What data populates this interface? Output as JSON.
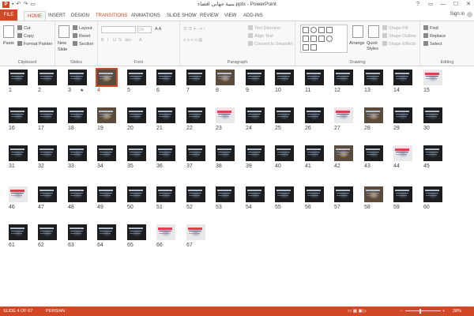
{
  "window": {
    "title": "بنبية جهاني افضاء.pptx - PowerPoint",
    "app_icon": "P",
    "qat": [
      "save-icon",
      "undo-icon",
      "redo-icon",
      "start-from-beginning-icon"
    ],
    "controls": [
      "?",
      "▭",
      "—",
      "☐",
      "✕"
    ]
  },
  "tabs": {
    "file": "FILE",
    "items": [
      "HOME",
      "INSERT",
      "DESIGN",
      "TRANSITIONS",
      "ANIMATIONS",
      "SLIDE SHOW",
      "REVIEW",
      "VIEW",
      "ADD-INS"
    ],
    "active": "HOME",
    "sign_in": "Sign in"
  },
  "ribbon": {
    "clipboard": {
      "label": "Clipboard",
      "paste": "Paste",
      "cut": "Cut",
      "copy": "Copy",
      "format_painter": "Format Painter"
    },
    "slides": {
      "label": "Slides",
      "new_slide": "New",
      "new_slide2": "Slide",
      "layout": "Layout",
      "reset": "Reset",
      "section": "Section"
    },
    "font": {
      "label": "Font",
      "size": "24"
    },
    "paragraph": {
      "label": "Paragraph",
      "text_direction": "Text Direction",
      "align_text": "Align Text",
      "convert_smartart": "Convert to SmartArt"
    },
    "drawing": {
      "label": "Drawing",
      "arrange": "Arrange",
      "quick_styles": "Quick Styles",
      "quick": "Quick",
      "styles": "Styles",
      "shape_fill": "Shape Fill",
      "shape_outline": "Shape Outline",
      "shape_effects": "Shape Effects"
    },
    "editing": {
      "label": "Editing",
      "find": "Find",
      "replace": "Replace",
      "select": "Select"
    }
  },
  "slides": {
    "count": 67,
    "selected": 4,
    "numbers": [
      "1",
      "2",
      "3",
      "4",
      "5",
      "6",
      "7",
      "8",
      "9",
      "10",
      "11",
      "12",
      "13",
      "14",
      "15",
      "16",
      "17",
      "18",
      "19",
      "20",
      "21",
      "22",
      "23",
      "24",
      "25",
      "26",
      "27",
      "28",
      "29",
      "30",
      "31",
      "32",
      "33",
      "34",
      "35",
      "36",
      "37",
      "38",
      "39",
      "40",
      "41",
      "42",
      "43",
      "44",
      "45",
      "46",
      "47",
      "48",
      "49",
      "50",
      "51",
      "52",
      "53",
      "54",
      "55",
      "56",
      "57",
      "58",
      "59",
      "60",
      "61",
      "62",
      "63",
      "64",
      "65",
      "66",
      "67"
    ],
    "light": [
      15,
      23,
      27,
      44,
      46,
      66,
      67
    ],
    "photo": [
      4,
      8,
      19,
      28,
      42,
      58
    ],
    "star_on": 3
  },
  "status": {
    "slide_info": "SLIDE 4 OF 67",
    "language": "PERSIAN",
    "zoom": "28%",
    "zoom_fraction": 0.4
  },
  "colors": {
    "accent": "#d24726",
    "ribbon_bg": "#f8f8f8"
  }
}
